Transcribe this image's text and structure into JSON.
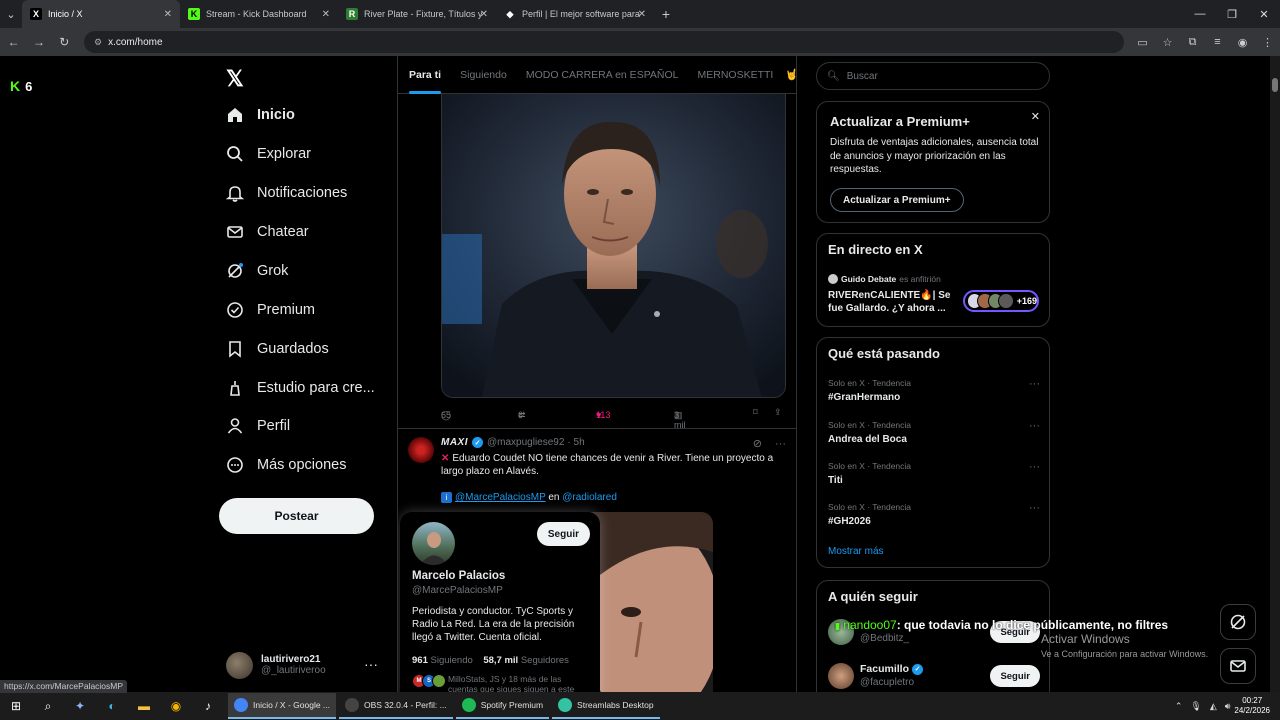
{
  "browser": {
    "tabs": [
      {
        "title": "Inicio / X",
        "fav": "X",
        "fav_bg": "#000000",
        "fav_color": "#ffffff"
      },
      {
        "title": "Stream - Kick Dashboard",
        "fav": "K",
        "fav_bg": "#53fc18",
        "fav_color": "#000000"
      },
      {
        "title": "River Plate - Fixture, Títulos y P",
        "fav": "R",
        "fav_bg": "#2e7d32",
        "fav_color": "#ffffff"
      },
      {
        "title": "Perfil | El mejor software para p",
        "fav": "◆",
        "fav_bg": "#202124",
        "fav_color": "#ffffff"
      }
    ],
    "url": "x.com/home",
    "status_url": "https://x.com/MarcePalaciosMP"
  },
  "kick_badge": {
    "count": "6"
  },
  "nav": {
    "items": [
      {
        "label": "Inicio",
        "icon": "home-icon"
      },
      {
        "label": "Explorar",
        "icon": "search-icon"
      },
      {
        "label": "Notificaciones",
        "icon": "bell-icon"
      },
      {
        "label": "Chatear",
        "icon": "mail-icon"
      },
      {
        "label": "Grok",
        "icon": "grok-icon"
      },
      {
        "label": "Premium",
        "icon": "premium-icon"
      },
      {
        "label": "Guardados",
        "icon": "bookmark-icon"
      },
      {
        "label": "Estudio para cre...",
        "icon": "studio-icon"
      },
      {
        "label": "Perfil",
        "icon": "person-icon"
      },
      {
        "label": "Más opciones",
        "icon": "more-circle-icon"
      }
    ],
    "post_button": "Postear",
    "user": {
      "name": "lautirivero21",
      "handle": "@_lautiriveroo"
    }
  },
  "timeline": {
    "tabs": [
      "Para ti",
      "Siguiendo",
      "MODO CARRERA en ESPAÑOL",
      "MERNOSKETTI"
    ],
    "tweet1_actions": {
      "replies": "65",
      "retweets": "6",
      "likes": "113",
      "views": "3 mil"
    },
    "tweet2": {
      "name": "MAXI",
      "handle": "@maxpugliese92",
      "time": "· 5h",
      "text": "Eduardo Coudet NO tiene chances de venir a River. Tiene un proyecto a largo plazo en Alavés.",
      "mention": "@MarcePalaciosMP",
      "connector": "en",
      "source": "@radiolared"
    }
  },
  "hover_card": {
    "follow": "Seguir",
    "name": "Marcelo Palacios",
    "handle": "@MarcePalaciosMP",
    "bio": "Periodista y conductor. TyC Sports y Radio La Red. La era de la precisión llegó a Twitter. Cuenta oficial.",
    "following_count": "961",
    "following_label": "Siguiendo",
    "followers_count": "58,7 mil",
    "followers_label": "Seguidores",
    "mutual": "MilloStats, JS y 18 más de las cuentas que sigues siguen a este"
  },
  "right": {
    "search_placeholder": "Buscar",
    "premium": {
      "title": "Actualizar a Premium+",
      "desc": "Disfruta de ventajas adicionales, ausencia total de anuncios y mayor priorización en las respuestas.",
      "button": "Actualizar a Premium+"
    },
    "live": {
      "title": "En directo en X",
      "host": "Guido Debate",
      "host_suffix": "es anfitrión",
      "space_title": "RIVERenCALIENTE🔥| Se fue Gallardo. ¿Y ahora ...",
      "listeners": "+169"
    },
    "trends": {
      "title": "Qué está pasando",
      "items": [
        {
          "meta": "Solo en X · Tendencia",
          "name": "#GranHermano"
        },
        {
          "meta": "Solo en X · Tendencia",
          "name": "Andrea del Boca"
        },
        {
          "meta": "Solo en X · Tendencia",
          "name": "Titi"
        },
        {
          "meta": "Solo en X · Tendencia",
          "name": "#GH2026"
        }
      ],
      "more": "Mostrar más"
    },
    "who_to_follow": {
      "title": "A quién seguir",
      "items": [
        {
          "name": "",
          "handle": "@Bedbitz_",
          "button": "Seguir"
        },
        {
          "name": "Facumillo",
          "handle": "@facupletro",
          "button": "Seguir"
        }
      ]
    }
  },
  "overlays": {
    "chat_user": "nandoo07",
    "chat_message": ": que todavia no lo dice públicamente, no filtres",
    "activate_title": "Activar Windows",
    "activate_sub": "Ve a Configuración para activar Windows."
  },
  "taskbar": {
    "apps": [
      {
        "label": "Inicio / X - Google ...",
        "color": "#4285f4"
      },
      {
        "label": "OBS 32.0.4 - Perfil: ...",
        "color": "#444444"
      },
      {
        "label": "Spotify Premium",
        "color": "#1db954"
      },
      {
        "label": "Streamlabs Desktop",
        "color": "#31c3a2"
      }
    ],
    "time": "00:27",
    "date": "24/2/2026"
  }
}
